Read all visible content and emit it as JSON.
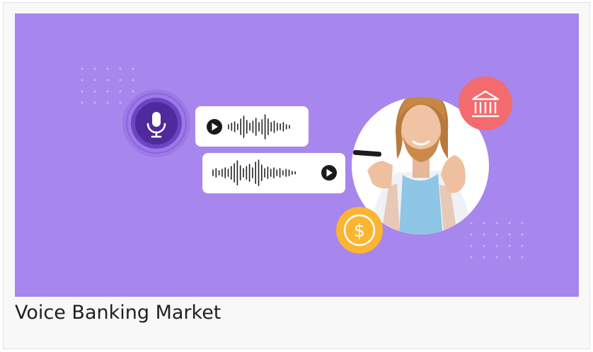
{
  "card": {
    "title": "Voice Banking Market"
  },
  "illustration": {
    "background_color": "#a786ee",
    "mic_color": "#4f2a9c",
    "bank_badge_color": "#f36b6e",
    "coin_badge_color": "#fbb533",
    "icons": [
      "microphone-icon",
      "play-icon",
      "bank-icon",
      "dollar-coin-icon"
    ]
  }
}
